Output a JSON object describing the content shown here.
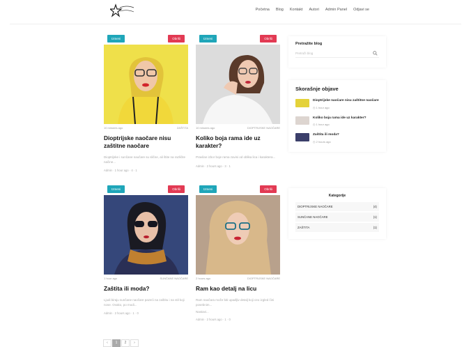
{
  "nav": [
    "Početna",
    "Blog",
    "Kontakt",
    "Autori",
    "Admin Panel",
    "Odjavi se"
  ],
  "posts": [
    {
      "tag_left": "Izmeni",
      "tag_right": "Obriši",
      "date": "10 minutes ago",
      "category": "ZAŠTITA",
      "title": "Dioptrijske naočare nisu zaštitne naočare",
      "excerpt": "Dioptrijske i sunčane naočare su slične, ali štite na različite načine...",
      "readmore": "",
      "stats": "Admin · 1 hour ago · 4 · 1"
    },
    {
      "tag_left": "Izmeni",
      "tag_right": "Obriši",
      "date": "10 minutes ago",
      "category": "DIOPTRIJSKE NAOČARE",
      "title": "Koliko boja rama ide uz karakter?",
      "excerpt": "Pravilan izbor boje rama zavisi od oblika lica i karaktera...",
      "readmore": "",
      "stats": "Admin · 2 hours ago · 3 · 1"
    },
    {
      "tag_left": "Izmeni",
      "tag_right": "Obriši",
      "date": "1 hour ago",
      "category": "SUNČANE NAOČARE",
      "title": "Zaštita ili moda?",
      "excerpt": "Ljudi biraju sunčane naočare pazeći na zaštitu i na stil koji nose. Ovako, po modi...",
      "readmore": "",
      "stats": "Admin · 2 hours ago · 1 · 0"
    },
    {
      "tag_left": "Izmeni",
      "tag_right": "Obriši",
      "date": "2 hours ago",
      "category": "DIOPTRIJSKE NAOČARE",
      "title": "Ram kao detalj na licu",
      "excerpt": "Ram naočara može biti upadljiv detalj koji ceo izgled čini posebnim...",
      "readmore": "Nastavi...",
      "stats": "Admin · 2 hours ago · 1 · 0"
    }
  ],
  "search": {
    "title": "Pretražite blog",
    "placeholder": "Pretraži blog"
  },
  "recent": {
    "title": "Skorašnje objave",
    "items": [
      {
        "title": "Dioptrijske naočare nisu zaštitne naočare",
        "date": "1 hour ago"
      },
      {
        "title": "Koliko boja rama ide uz karakter?",
        "date": "1 hour ago"
      },
      {
        "title": "Zaštita ili moda?",
        "date": "2 hours ago"
      }
    ]
  },
  "categories": {
    "title": "Kategorije",
    "items": [
      {
        "name": "DIOPTRIJSKE NAOČARE",
        "count": "(4)"
      },
      {
        "name": "SUNČANE NAOČARE",
        "count": "(1)"
      },
      {
        "name": "ZAŠTITA",
        "count": "(1)"
      }
    ]
  },
  "pager": [
    "‹",
    "1",
    "2",
    "›"
  ]
}
